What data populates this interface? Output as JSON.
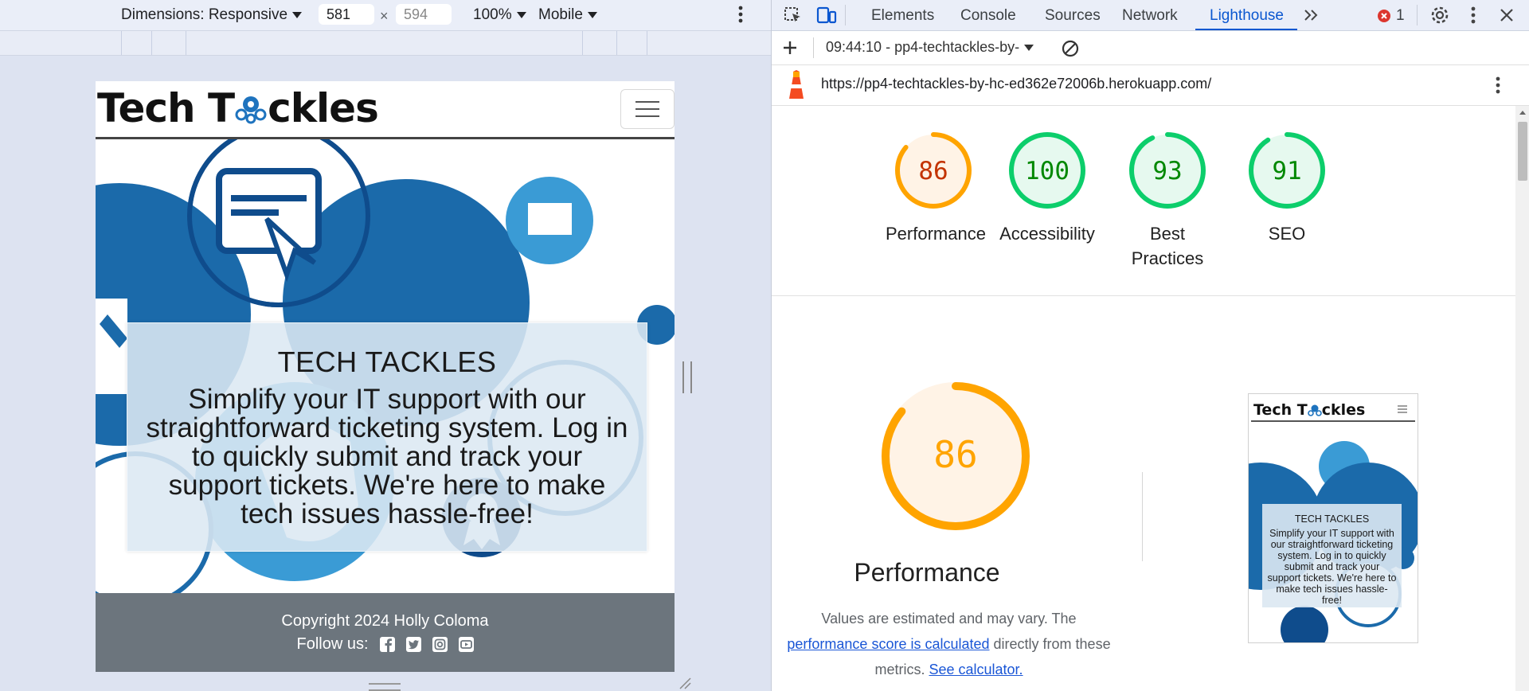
{
  "device_toolbar": {
    "dimensions_label": "Dimensions: Responsive",
    "width_value": "581",
    "height_placeholder": "594",
    "zoom": "100%",
    "throttle": "Mobile"
  },
  "site": {
    "logo_text_before": "Tech T",
    "logo_text_after": "ckles",
    "hero_title": "TECH TACKLES",
    "hero_text": "Simplify your IT support with our straightforward ticketing system. Log in to quickly submit and track your support tickets. We're here to make tech issues hassle-free!",
    "copyright": "Copyright 2024 Holly Coloma",
    "follow_label": "Follow us:",
    "social_icons": [
      "facebook-icon",
      "twitter-icon",
      "instagram-icon",
      "youtube-icon"
    ]
  },
  "devtools": {
    "tabs": [
      "Elements",
      "Console",
      "Sources",
      "Network",
      "Lighthouse"
    ],
    "active_tab": "Lighthouse",
    "error_count": "1",
    "report_selector": "09:44:10 - pp4-techtackles-by-",
    "url": "https://pp4-techtackles-by-hc-ed362e72006b.herokuapp.com/"
  },
  "scores": [
    {
      "label": "Performance",
      "value": "86",
      "color": "#ffa400",
      "fill": "#fff3e6",
      "text_color": "#c33300"
    },
    {
      "label": "Accessibility",
      "value": "100",
      "color": "#0cce6b",
      "fill": "#e6f9ef",
      "text_color": "#008800"
    },
    {
      "label": "Best Practices",
      "value": "93",
      "color": "#0cce6b",
      "fill": "#e6f9ef",
      "text_color": "#008800"
    },
    {
      "label": "SEO",
      "value": "91",
      "color": "#0cce6b",
      "fill": "#e6f9ef",
      "text_color": "#008800"
    }
  ],
  "performance_section": {
    "score": "86",
    "title": "Performance",
    "note_prefix": "Values are estimated and may vary. The",
    "note_link": "performance score is calculated",
    "note_middle": "directly from these metrics.",
    "note_link2": "See calculator."
  },
  "thumbnail": {
    "logo_before": "Tech T",
    "logo_after": "ckles",
    "title": "TECH TACKLES",
    "text": "Simplify your IT support with our straightforward ticketing system. Log in to quickly submit and track your support tickets. We're here to make tech issues hassle-free!"
  },
  "colors": {
    "accent_blue": "#0b57d0",
    "footer_gray": "#6c757d",
    "orange": "#ffa400",
    "green": "#0cce6b"
  }
}
